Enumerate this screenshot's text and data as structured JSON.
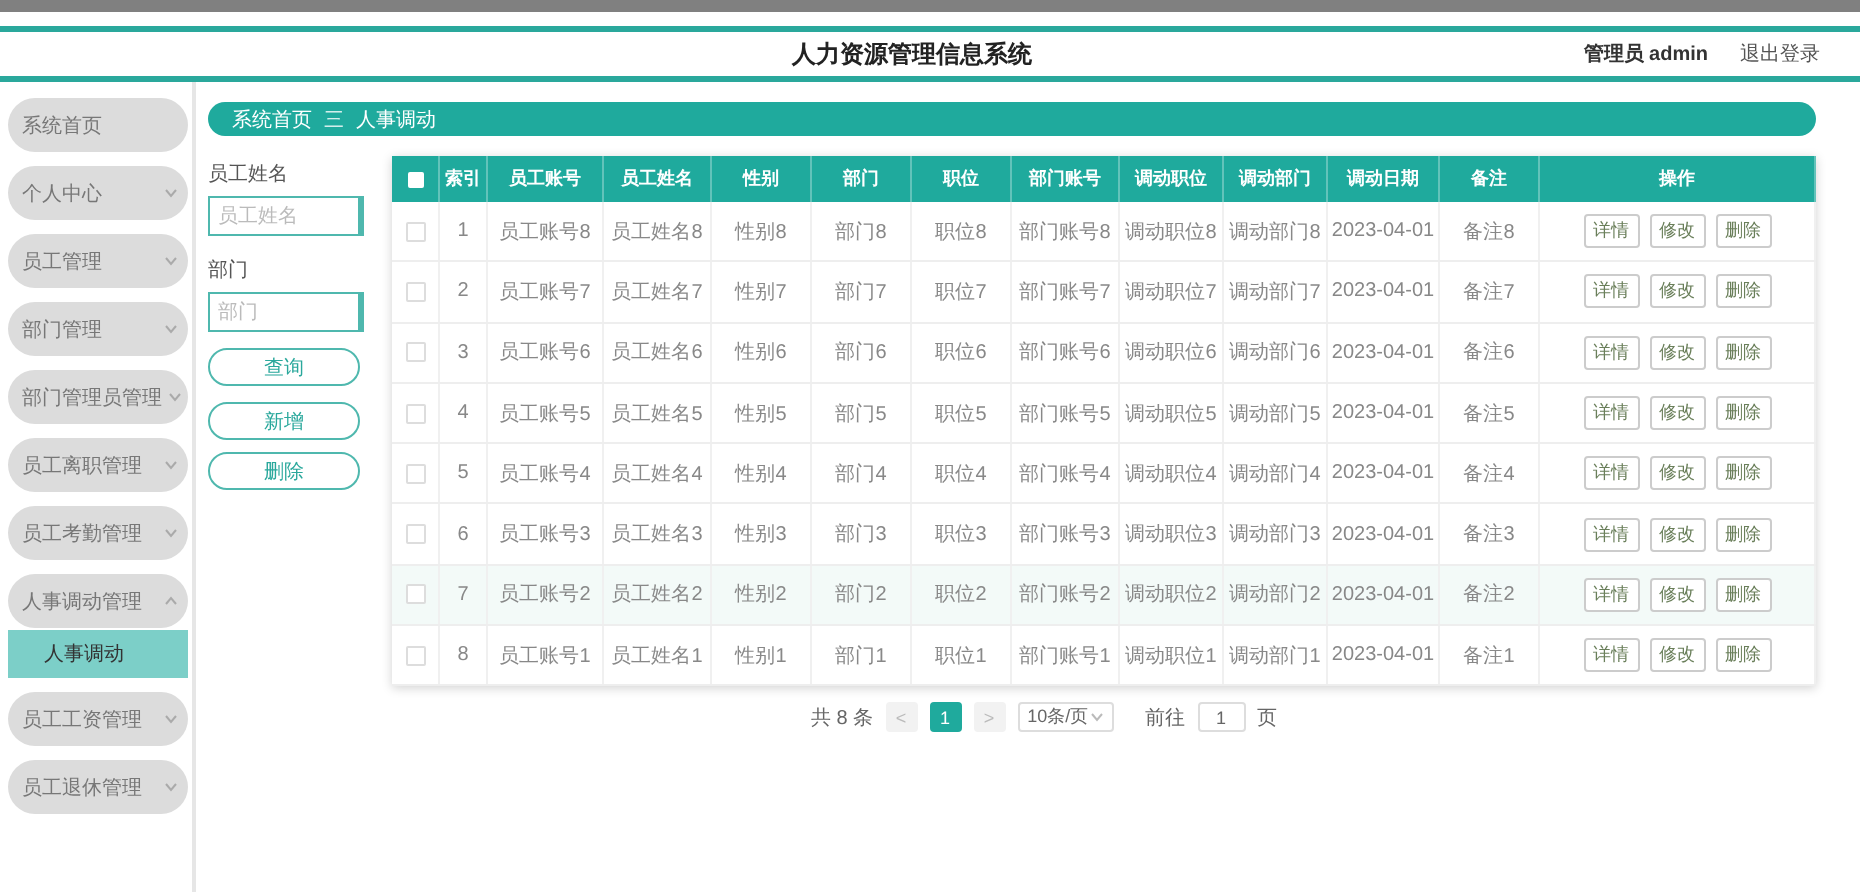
{
  "header": {
    "title": "人力资源管理信息系统",
    "user": "管理员 admin",
    "logout": "退出登录"
  },
  "sidebar": {
    "items": [
      {
        "label": "系统首页"
      },
      {
        "label": "个人中心",
        "expanded": false
      },
      {
        "label": "员工管理",
        "expanded": false
      },
      {
        "label": "部门管理",
        "expanded": false
      },
      {
        "label": "部门管理员管理",
        "expanded": false
      },
      {
        "label": "员工离职管理",
        "expanded": false
      },
      {
        "label": "员工考勤管理",
        "expanded": false
      },
      {
        "label": "人事调动管理",
        "expanded": true,
        "children": [
          {
            "label": "人事调动",
            "selected": true
          }
        ]
      },
      {
        "label": "员工工资管理",
        "expanded": false
      },
      {
        "label": "员工退休管理",
        "expanded": false
      }
    ]
  },
  "breadcrumb": {
    "items": [
      "系统首页",
      "人事调动"
    ],
    "separator": "三"
  },
  "filters": {
    "fields": [
      {
        "label": "员工姓名",
        "placeholder": "员工姓名"
      },
      {
        "label": "部门",
        "placeholder": "部门"
      }
    ],
    "buttons": [
      "查询",
      "新增",
      "删除"
    ]
  },
  "table": {
    "select_all_checked": false,
    "columns": [
      "索引",
      "员工账号",
      "员工姓名",
      "性别",
      "部门",
      "职位",
      "部门账号",
      "调动职位",
      "调动部门",
      "调动日期",
      "备注",
      "操作"
    ],
    "rows": [
      {
        "checked": false,
        "hovered": false,
        "cells": [
          "1",
          "员工账号8",
          "员工姓名8",
          "性别8",
          "部门8",
          "职位8",
          "部门账号8",
          "调动职位8",
          "调动部门8",
          "2023-04-01",
          "备注8"
        ],
        "actions": [
          "详情",
          "修改",
          "删除"
        ]
      },
      {
        "checked": false,
        "hovered": false,
        "cells": [
          "2",
          "员工账号7",
          "员工姓名7",
          "性别7",
          "部门7",
          "职位7",
          "部门账号7",
          "调动职位7",
          "调动部门7",
          "2023-04-01",
          "备注7"
        ],
        "actions": [
          "详情",
          "修改",
          "删除"
        ]
      },
      {
        "checked": false,
        "hovered": false,
        "cells": [
          "3",
          "员工账号6",
          "员工姓名6",
          "性别6",
          "部门6",
          "职位6",
          "部门账号6",
          "调动职位6",
          "调动部门6",
          "2023-04-01",
          "备注6"
        ],
        "actions": [
          "详情",
          "修改",
          "删除"
        ]
      },
      {
        "checked": false,
        "hovered": false,
        "cells": [
          "4",
          "员工账号5",
          "员工姓名5",
          "性别5",
          "部门5",
          "职位5",
          "部门账号5",
          "调动职位5",
          "调动部门5",
          "2023-04-01",
          "备注5"
        ],
        "actions": [
          "详情",
          "修改",
          "删除"
        ]
      },
      {
        "checked": false,
        "hovered": false,
        "cells": [
          "5",
          "员工账号4",
          "员工姓名4",
          "性别4",
          "部门4",
          "职位4",
          "部门账号4",
          "调动职位4",
          "调动部门4",
          "2023-04-01",
          "备注4"
        ],
        "actions": [
          "详情",
          "修改",
          "删除"
        ]
      },
      {
        "checked": false,
        "hovered": false,
        "cells": [
          "6",
          "员工账号3",
          "员工姓名3",
          "性别3",
          "部门3",
          "职位3",
          "部门账号3",
          "调动职位3",
          "调动部门3",
          "2023-04-01",
          "备注3"
        ],
        "actions": [
          "详情",
          "修改",
          "删除"
        ]
      },
      {
        "checked": false,
        "hovered": true,
        "cells": [
          "7",
          "员工账号2",
          "员工姓名2",
          "性别2",
          "部门2",
          "职位2",
          "部门账号2",
          "调动职位2",
          "调动部门2",
          "2023-04-01",
          "备注2"
        ],
        "actions": [
          "详情",
          "修改",
          "删除"
        ]
      },
      {
        "checked": false,
        "hovered": false,
        "cells": [
          "8",
          "员工账号1",
          "员工姓名1",
          "性别1",
          "部门1",
          "职位1",
          "部门账号1",
          "调动职位1",
          "调动部门1",
          "2023-04-01",
          "备注1"
        ],
        "actions": [
          "详情",
          "修改",
          "删除"
        ]
      }
    ]
  },
  "pagination": {
    "total": "共 8 条",
    "prev": "<",
    "pages": [
      {
        "label": "1",
        "selected": true
      }
    ],
    "next": ">",
    "page_size": "10条/页",
    "goto_label": "前往",
    "goto_value": "1",
    "goto_suffix": "页"
  }
}
